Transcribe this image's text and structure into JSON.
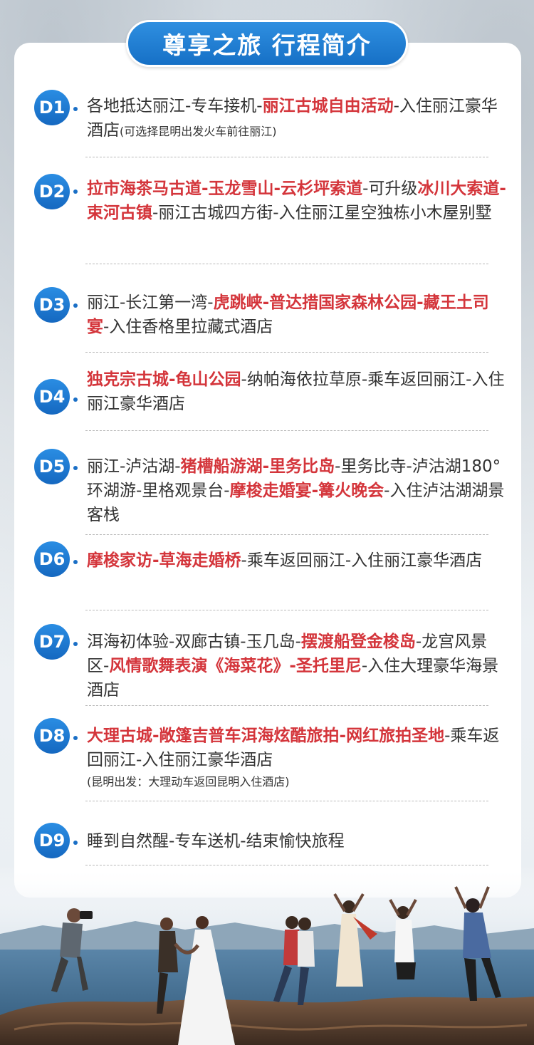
{
  "title": "尊享之旅 行程简介",
  "accent_color": "#1a74cc",
  "highlight_color": "#d4353b",
  "days": [
    {
      "badge": "D1",
      "segments": [
        {
          "t": "各地抵达丽江-专车接机-",
          "h": false
        },
        {
          "t": "丽江古城自由活动",
          "h": true
        },
        {
          "t": "-入住丽江豪华酒店",
          "h": false
        }
      ],
      "inline_note": "(可选择昆明出发火车前往丽江)"
    },
    {
      "badge": "D2",
      "segments": [
        {
          "t": "拉市海茶马古道-玉龙雪山-云杉坪索道",
          "h": true
        },
        {
          "t": "-可升级",
          "h": false
        },
        {
          "t": "冰川大索道-束河古镇",
          "h": true
        },
        {
          "t": "-丽江古城四方街-入住丽江星空独栋小木屋别墅",
          "h": false
        }
      ]
    },
    {
      "badge": "D3",
      "segments": [
        {
          "t": "丽江-长江第一湾-",
          "h": false
        },
        {
          "t": "虎跳峡-普达措国家森林公园-藏王土司宴",
          "h": true
        },
        {
          "t": "-入住香格里拉藏式酒店",
          "h": false
        }
      ]
    },
    {
      "badge": "D4",
      "segments": [
        {
          "t": "独克宗古城-龟山公园",
          "h": true
        },
        {
          "t": "-纳帕海依拉草原-乘车返回丽江-入住丽江豪华酒店",
          "h": false
        }
      ]
    },
    {
      "badge": "D5",
      "segments": [
        {
          "t": "丽江-泸沽湖-",
          "h": false
        },
        {
          "t": "猪槽船游湖-里务比岛",
          "h": true
        },
        {
          "t": "-里务比寺-泸沽湖180°环湖游-里格观景台-",
          "h": false
        },
        {
          "t": "摩梭走婚宴-篝火晚会",
          "h": true
        },
        {
          "t": "-入住泸沽湖湖景客栈",
          "h": false
        }
      ]
    },
    {
      "badge": "D6",
      "segments": [
        {
          "t": "摩梭家访-草海走婚桥",
          "h": true
        },
        {
          "t": "-乘车返回丽江-入住丽江豪华酒店",
          "h": false
        }
      ]
    },
    {
      "badge": "D7",
      "segments": [
        {
          "t": "洱海初体验-双廊古镇-玉几岛-",
          "h": false
        },
        {
          "t": "摆渡船登金梭岛",
          "h": true
        },
        {
          "t": "-龙宫风景区-",
          "h": false
        },
        {
          "t": "风情歌舞表演《海菜花》-圣托里尼",
          "h": true
        },
        {
          "t": "-入住大理豪华海景酒店",
          "h": false
        }
      ]
    },
    {
      "badge": "D8",
      "segments": [
        {
          "t": "大理古城-敞篷吉普车洱海炫酷旅拍-网红旅拍圣地",
          "h": true
        },
        {
          "t": "-乘车返回丽江-入住丽江豪华酒店",
          "h": false
        }
      ],
      "note": "(昆明出发：大理动车返回昆明入住酒店)"
    },
    {
      "badge": "D9",
      "segments": [
        {
          "t": "睡到自然醒-专车送机-结束愉快旅程",
          "h": false
        }
      ]
    }
  ]
}
